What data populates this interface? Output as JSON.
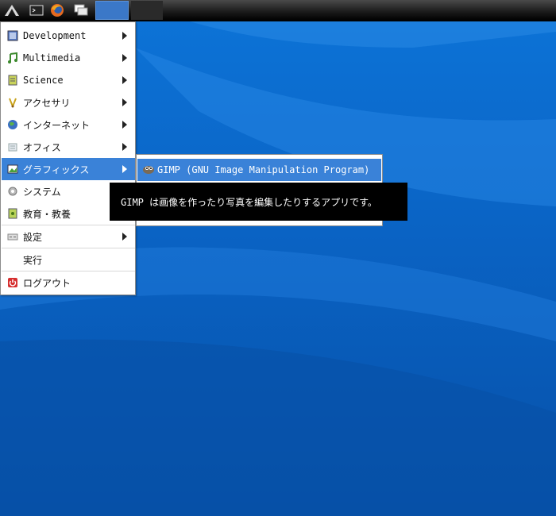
{
  "panel": {
    "icons": [
      "lxde-logo-icon",
      "terminal-icon",
      "firefox-icon",
      "windows-icon"
    ]
  },
  "menu": {
    "items": [
      {
        "label": "Development",
        "icon": "development-icon",
        "submenu": true
      },
      {
        "label": "Multimedia",
        "icon": "multimedia-icon",
        "submenu": true
      },
      {
        "label": "Science",
        "icon": "science-icon",
        "submenu": true
      },
      {
        "label": "アクセサリ",
        "icon": "accessories-icon",
        "submenu": true
      },
      {
        "label": "インターネット",
        "icon": "internet-icon",
        "submenu": true
      },
      {
        "label": "オフィス",
        "icon": "office-icon",
        "submenu": true
      },
      {
        "label": "グラフィックス",
        "icon": "graphics-icon",
        "submenu": true,
        "active": true
      },
      {
        "label": "システム",
        "icon": "system-icon",
        "submenu": false
      },
      {
        "label": "教育・教養",
        "icon": "education-icon",
        "submenu": false
      },
      {
        "label": "設定",
        "icon": "settings-icon",
        "submenu": true
      },
      {
        "label": "実行",
        "icon": "",
        "submenu": false
      },
      {
        "label": "ログアウト",
        "icon": "logout-icon",
        "submenu": false
      }
    ]
  },
  "submenu": {
    "items": [
      {
        "label": "GIMP (GNU Image Manipulation Program)",
        "icon": "gimp-icon"
      }
    ]
  },
  "tooltip": {
    "text": "GIMP は画像を作ったり写真を編集したりするアプリです。"
  },
  "colors": {
    "highlight": "#3a82d8",
    "desktop": "#0a63c4",
    "panel": "#1c1c1c",
    "tooltip_bg": "#000000"
  }
}
